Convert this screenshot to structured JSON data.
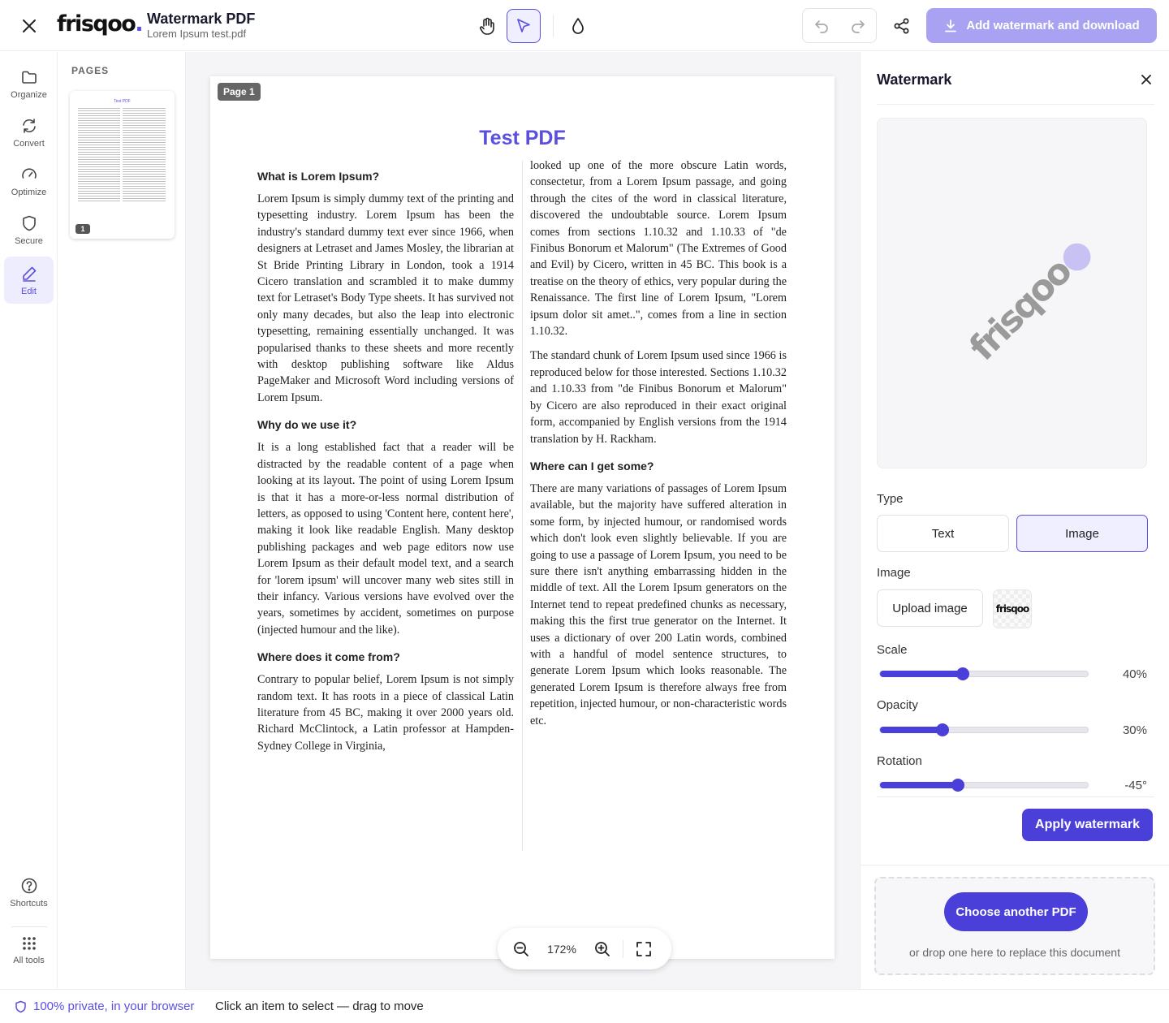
{
  "topbar": {
    "brand_name": "frisqoo",
    "brand_dot": ".",
    "app_title": "Watermark PDF",
    "file_name": "Lorem Ipsum test.pdf",
    "download_label": "Add watermark and download"
  },
  "rail": {
    "items": [
      {
        "label": "Organize",
        "icon": "folder-icon"
      },
      {
        "label": "Convert",
        "icon": "refresh-icon"
      },
      {
        "label": "Optimize",
        "icon": "gauge-icon"
      },
      {
        "label": "Secure",
        "icon": "shield-icon"
      },
      {
        "label": "Edit",
        "icon": "pencil-icon",
        "active": true
      }
    ],
    "bottom": [
      {
        "label": "Shortcuts",
        "icon": "help-icon"
      },
      {
        "label": "All tools",
        "icon": "grid-icon"
      }
    ]
  },
  "pages_panel": {
    "title": "PAGES",
    "thumb_title": "Test PDF",
    "thumbs": [
      {
        "number": "1"
      }
    ]
  },
  "document": {
    "page_label": "Page 1",
    "title": "Test PDF",
    "sections": [
      {
        "heading": "What is Lorem Ipsum?",
        "paragraph": "Lorem Ipsum is simply dummy text of the printing and typesetting industry. Lorem Ipsum has been the industry's standard dummy text ever since 1966, when designers at Letraset and James Mosley, the librarian at St Bride Printing Library in London, took a 1914 Cicero translation and scrambled it to make dummy text for Letraset's Body Type sheets. It has survived not only many decades, but also the leap into electronic typesetting, remaining essentially unchanged. It was popularised thanks to these sheets and more recently with desktop publishing software like Aldus PageMaker and Microsoft Word including versions of Lorem Ipsum."
      },
      {
        "heading": "Why do we use it?",
        "paragraph": "It is a long established fact that a reader will be distracted by the readable content of a page when looking at its layout. The point of using Lorem Ipsum is that it has a more-or-less normal distribution of letters, as opposed to using 'Content here, content here', making it look like readable English. Many desktop publishing packages and web page editors now use Lorem Ipsum as their default model text, and a search for 'lorem ipsum' will uncover many web sites still in their infancy. Various versions have evolved over the years, sometimes by accident, sometimes on purpose (injected humour and the like)."
      },
      {
        "heading": "Where does it come from?",
        "paragraph": "Contrary to popular belief, Lorem Ipsum is not simply random text. It has roots in a piece of classical Latin literature from 45 BC, making it over 2000 years old. Richard McClintock, a Latin professor at Hampden-Sydney College in Virginia,"
      }
    ],
    "right_paragraphs": [
      "looked up one of the more obscure Latin words, consectetur, from a Lorem Ipsum passage, and going through the cites of the word in classical literature, discovered the undoubtable source. Lorem Ipsum comes from sections 1.10.32 and 1.10.33 of \"de Finibus Bonorum et Malorum\" (The Extremes of Good and Evil) by Cicero, written in 45 BC. This book is a treatise on the theory of ethics, very popular during the Renaissance. The first line of Lorem Ipsum, \"Lorem ipsum dolor sit amet..\", comes from a line in section 1.10.32.",
      "The standard chunk of Lorem Ipsum used since 1966 is reproduced below for those interested. Sections 1.10.32 and 1.10.33 from \"de Finibus Bonorum et Malorum\" by Cicero are also reproduced in their exact original form, accompanied by English versions from the 1914 translation by H. Rackham."
    ],
    "right_section": {
      "heading": "Where can I get some?",
      "paragraph": "There are many variations of passages of Lorem Ipsum available, but the majority have suffered alteration in some form, by injected humour, or randomised words which don't look even slightly believable. If you are going to use a passage of Lorem Ipsum, you need to be sure there isn't anything embarrassing hidden in the middle of text. All the Lorem Ipsum generators on the Internet tend to repeat predefined chunks as necessary, making this the first true generator on the Internet. It uses a dictionary of over 200 Latin words, combined with a handful of model sentence structures, to generate Lorem Ipsum which looks reasonable. The generated Lorem Ipsum is therefore always free from repetition, injected humour, or non-characteristic words etc."
    }
  },
  "zoom": {
    "value": "172%"
  },
  "watermark_panel": {
    "title": "Watermark",
    "type_label": "Type",
    "type_options": [
      "Text",
      "Image"
    ],
    "selected_type": "Image",
    "image_label": "Image",
    "upload_label": "Upload image",
    "preview_logo": "frisqoo",
    "scale": {
      "label": "Scale",
      "value": 40,
      "display": "40%",
      "min": 0,
      "max": 100
    },
    "opacity": {
      "label": "Opacity",
      "value": 30,
      "display": "30%",
      "min": 0,
      "max": 100
    },
    "rotation": {
      "label": "Rotation",
      "value": -45,
      "display": "-45°",
      "min": -180,
      "max": 180
    },
    "apply_label": "Apply watermark",
    "choose_label": "Choose another PDF",
    "drop_hint": "or drop one here to replace this document"
  },
  "statusbar": {
    "privacy": "100% private, in your browser",
    "hint": "Click an item to select — drag to move"
  },
  "colors": {
    "accent": "#4a3fd8",
    "accent_light": "#a9a2f2",
    "brand_dot": "#5b4fe0"
  }
}
